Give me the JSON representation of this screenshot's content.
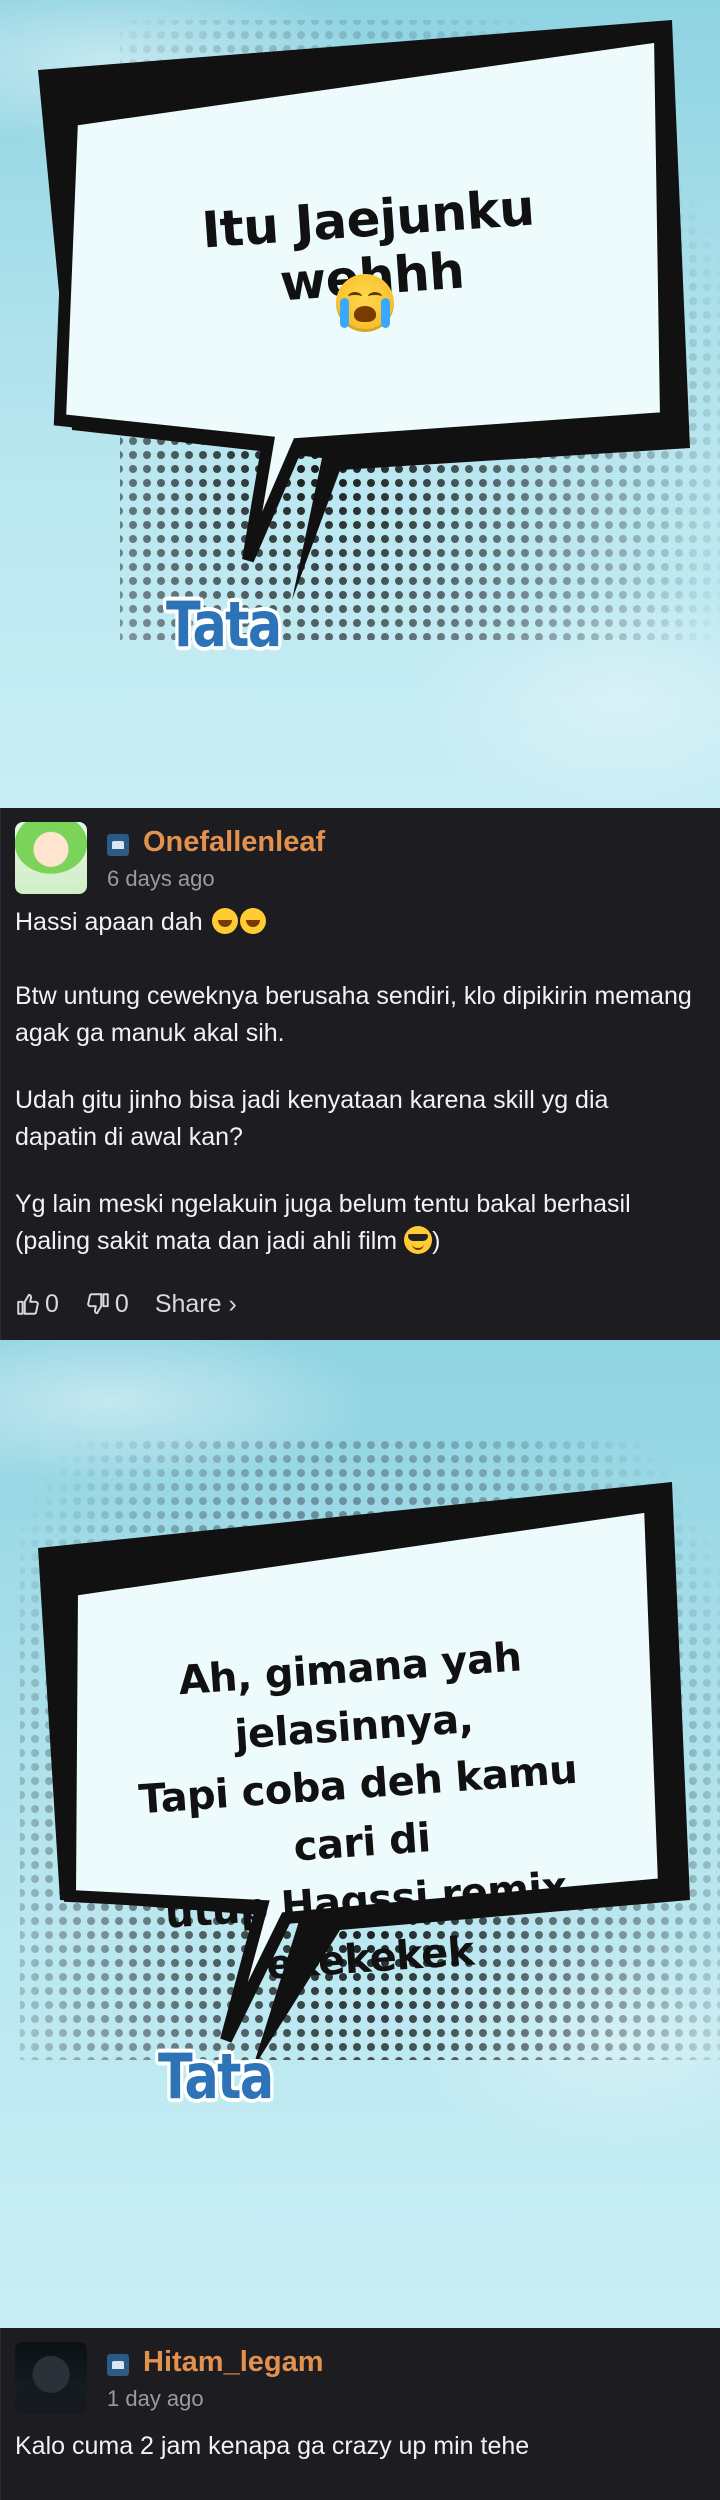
{
  "panel_top": {
    "bubble_line1": "Itu Jaejunku wehhh",
    "emoji": "loudly-crying-face",
    "signature": "Tata"
  },
  "comment1": {
    "username": "Onefallenleaf",
    "time": "6 days ago",
    "paragraphs": [
      "Hassi apaan dah",
      "Btw untung ceweknya berusaha sendiri, klo dipikirin memang agak ga manuk akal sih.",
      "Udah gitu jinho bisa jadi kenyataan karena skill yg dia dapatin di awal kan?",
      "Yg lain meski ngelakuin juga belum tentu bakal berhasil (paling sakit mata dan jadi ahli film"
    ],
    "paragraph4_end": ")",
    "likes": "0",
    "dislikes": "0",
    "share_label": "Share ›"
  },
  "panel_mid": {
    "bubble_line1": "Ah, gimana yah jelasinnya,",
    "bubble_line2": "Tapi coba deh kamu cari di",
    "bubble_line3": "utup Hagssi remix ekekekek",
    "signature": "Tata"
  },
  "comment2": {
    "username": "Hitam_legam",
    "time": "1 day ago",
    "text": "Kalo cuma 2 jam kenapa ga crazy up min tehe"
  },
  "colors": {
    "username": "#e3914e",
    "background": "#1c1c21",
    "signature": "#2c73b8"
  }
}
